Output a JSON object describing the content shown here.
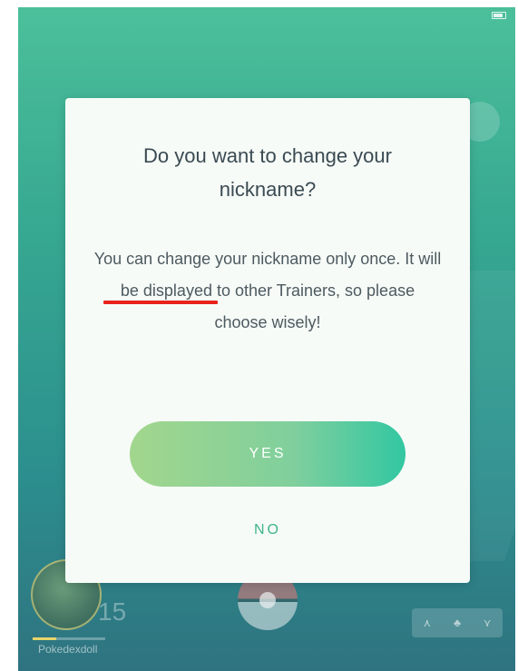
{
  "status_bar": {
    "left": "",
    "time": "",
    "right": ""
  },
  "dialog": {
    "title": "Do you want to change your nickname?",
    "message": "You can change your nickname only once. It will be displayed to other Trainers, so please choose wisely!",
    "yes_label": "YES",
    "no_label": "NO"
  },
  "player": {
    "level": "15",
    "username": "Pokedexdoll",
    "xp_progress": 0.32
  },
  "icons": {
    "nearby": [
      "footprint-icon",
      "pokemon-silhouette-icon",
      "footprint-icon"
    ]
  },
  "colors": {
    "accent": "#32c7a2",
    "highlight_underline": "#e8231d",
    "no_text": "#3fb48c"
  }
}
